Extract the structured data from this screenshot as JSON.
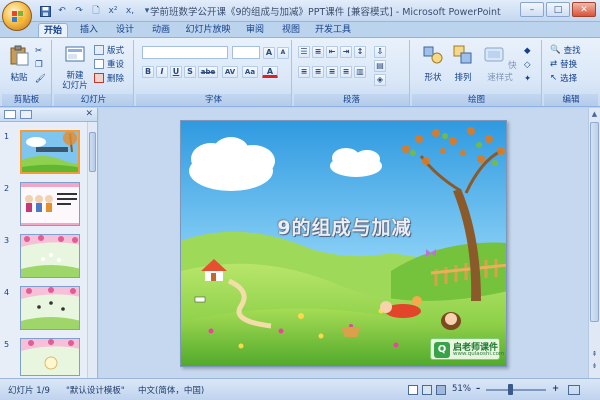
{
  "window": {
    "title": "学前班数学公开课《9的组成与加减》PPT课件 [兼容模式] - Microsoft PowerPoint",
    "controls": {
      "minimize": "–",
      "maximize": "□",
      "close": "✕"
    }
  },
  "qat": {
    "save": "💾",
    "undo": "↶",
    "redo": "↷",
    "new": "🗋",
    "format": "x²",
    "strike": "x,",
    "more": "▾"
  },
  "tabs": [
    {
      "label": "开始",
      "active": true
    },
    {
      "label": "插入"
    },
    {
      "label": "设计"
    },
    {
      "label": "动画"
    },
    {
      "label": "幻灯片放映"
    },
    {
      "label": "审阅"
    },
    {
      "label": "视图"
    },
    {
      "label": "开发工具"
    }
  ],
  "ribbon": {
    "clipboard": {
      "label": "剪贴板",
      "paste": "粘贴"
    },
    "slides": {
      "label": "幻灯片",
      "new_slide": "新建\n幻灯片",
      "layout": "版式",
      "reset": "重设",
      "delete": "删除"
    },
    "font": {
      "label": "字体",
      "bold": "B",
      "italic": "I",
      "underline": "U",
      "shadow": "S",
      "strike": "abe",
      "spacing": "AV",
      "case": "Aa",
      "color": "A"
    },
    "paragraph": {
      "label": "段落"
    },
    "drawing": {
      "label": "绘图",
      "shape": "形状",
      "arrange": "排列",
      "quick_styles": "快速样式"
    },
    "editing": {
      "label": "编辑",
      "find": "查找",
      "replace": "替换",
      "select": "选择"
    }
  },
  "left_panel": {
    "slides": [
      {
        "num": "1",
        "selected": true
      },
      {
        "num": "2"
      },
      {
        "num": "3"
      },
      {
        "num": "4"
      },
      {
        "num": "5"
      }
    ]
  },
  "slide": {
    "title": "9的组成与加减",
    "logo_main": "启老师课件",
    "logo_sub": "www.qulaoshi.com",
    "logo_q": "Q"
  },
  "status": {
    "slide_pos": "幻灯片 1/9",
    "template": "\"默认设计模板\"",
    "language": "中文(简体，中国)",
    "zoom": "51%"
  },
  "colors": {
    "accent": "#15428b",
    "ribbon": "#dbe8f8",
    "selected_thumb": "#f29b38"
  }
}
